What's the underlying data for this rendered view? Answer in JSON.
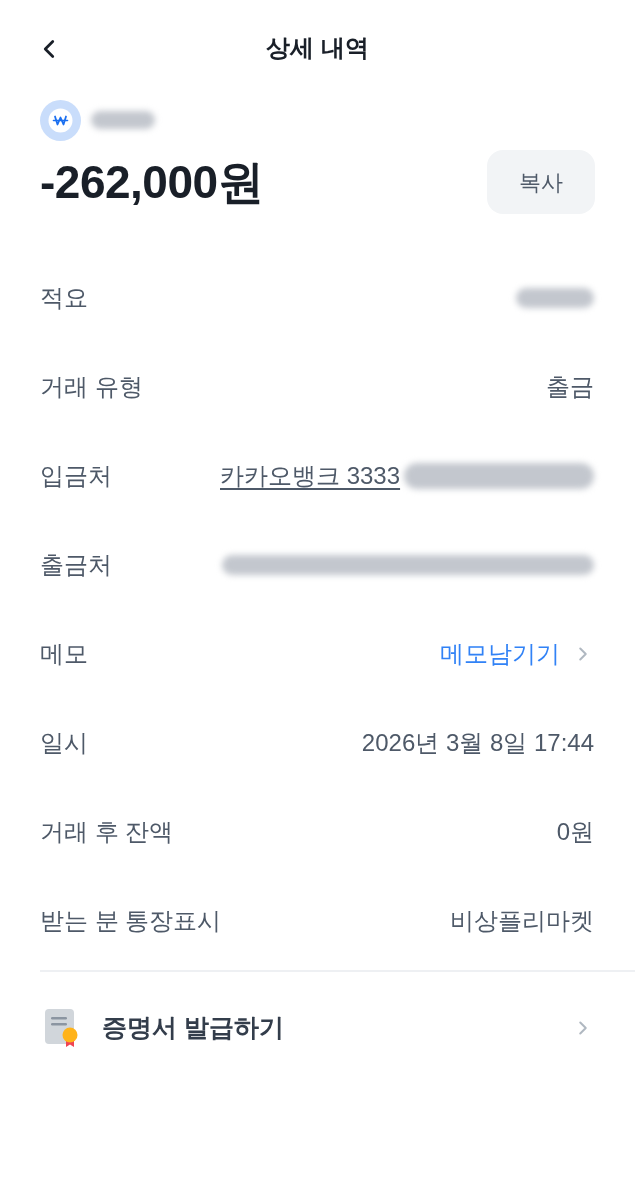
{
  "header": {
    "title": "상세 내역"
  },
  "summary": {
    "amount": "-262,000원",
    "copy_button": "복사"
  },
  "details": [
    {
      "label": "적요",
      "kind": "masked"
    },
    {
      "label": "거래 유형",
      "kind": "text",
      "value": "출금"
    },
    {
      "label": "입금처",
      "kind": "link",
      "value": "카카오뱅크 3333",
      "masked_suffix": true
    },
    {
      "label": "출금처",
      "kind": "masked_account"
    },
    {
      "label": "메모",
      "kind": "action",
      "value": "메모남기기"
    },
    {
      "label": "일시",
      "kind": "text",
      "value": "2026년 3월 8일 17:44"
    },
    {
      "label": "거래 후 잔액",
      "kind": "text",
      "value": "0원"
    },
    {
      "label": "받는 분 통장표시",
      "kind": "text",
      "value": "비상플리마켓"
    }
  ],
  "certificate": {
    "label": "증명서 발급하기"
  }
}
